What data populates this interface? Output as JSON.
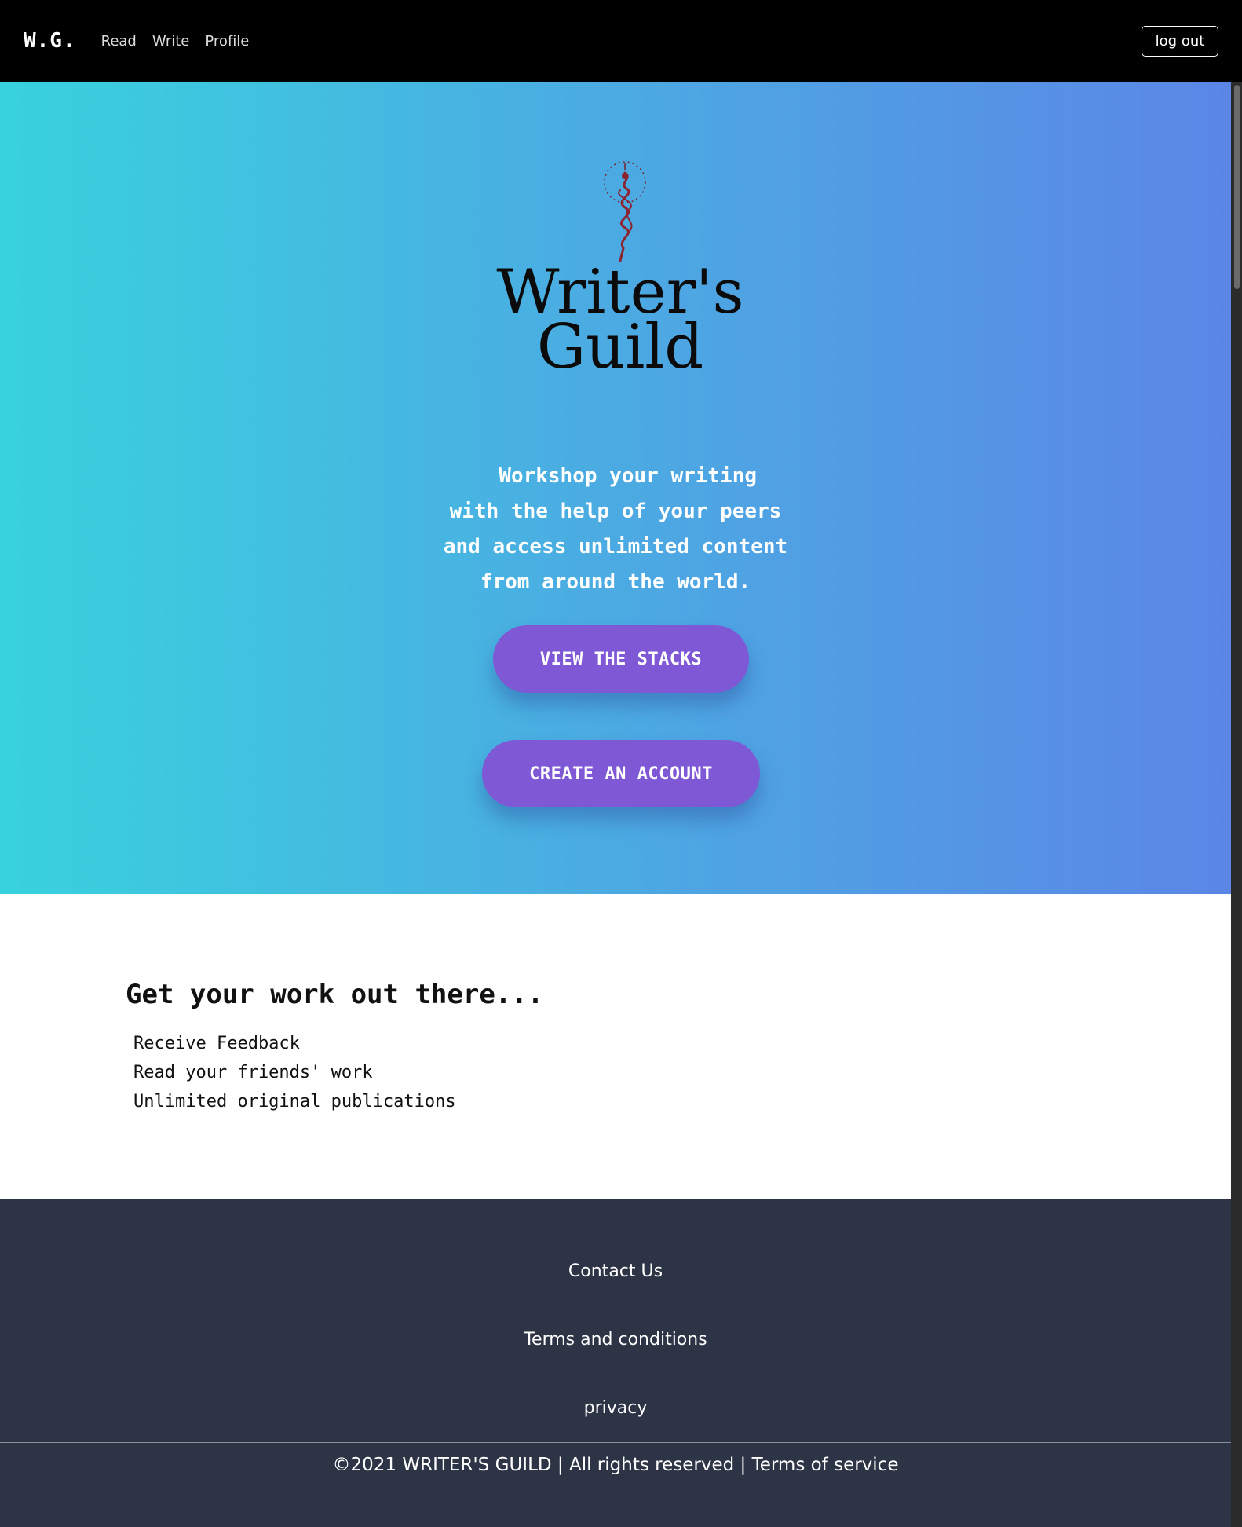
{
  "nav": {
    "brand": "W.G.",
    "links": [
      "Read",
      "Write",
      "Profile"
    ],
    "logout_label": "log out"
  },
  "hero": {
    "logo": {
      "line1": "Writer's",
      "line2": "Guild",
      "emblem": "serpent-emblem-icon"
    },
    "tagline": [
      "  Workshop your writing",
      "with the help of your peers",
      "and access unlimited content",
      "from around the world."
    ],
    "buttons": {
      "stacks_label": "VIEW THE STACKS",
      "create_label": "CREATE AN ACCOUNT"
    },
    "colors": {
      "gradient_start": "#38d2de",
      "gradient_end": "#5b86e6",
      "button": "#7f58d6"
    }
  },
  "features": {
    "title": "Get your work out there...",
    "items": [
      "Receive Feedback",
      "Read your friends' work",
      "Unlimited original publications"
    ]
  },
  "footer": {
    "contact_label": "Contact Us",
    "terms_label": "Terms and conditions",
    "privacy_label": "privacy",
    "copyright": "©2021 WRITER'S GUILD | All rights reserved | Terms of service",
    "background": "#2d3446"
  }
}
